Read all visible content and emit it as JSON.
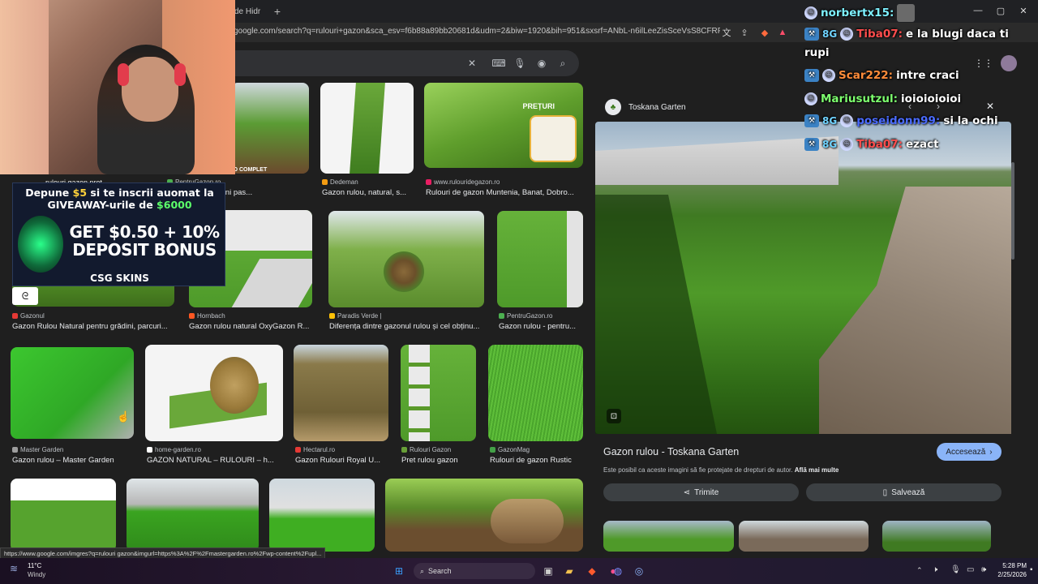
{
  "browser": {
    "tab_partial": "de Hidr",
    "url": "google.com/search?q=rulouri+gazon&sca_esv=f6b88a89bb20681d&udm=2&biw=1920&bih=951&sxsrf=ANbL-n6ilLeeZisSceVsS8CFRF9ZWOZ..."
  },
  "results": [
    {
      "source": "PentruGazon.ro",
      "caption": "...ontaj, instructiuni pas..."
    },
    {
      "source": "Dedeman",
      "caption": "Gazon rulou, natural, s..."
    },
    {
      "source": "www.rulouridegazon.ro",
      "caption": "Rulouri de gazon Muntenia, Banat, Dobro...",
      "badge": "PREȚURI"
    },
    {
      "source": "Gazonul",
      "caption": "Gazon Rulou Natural pentru grădini, parcuri..."
    },
    {
      "source": "Hornbach",
      "caption": "Gazon rulou natural OxyGazon R..."
    },
    {
      "source": "Paradis Verde |",
      "caption": "Diferența dintre gazonul rulou și cel obținu..."
    },
    {
      "source": "PentruGazon.ro",
      "caption": "Gazon rulou - pentru..."
    },
    {
      "source": "Master Garden",
      "caption": "Gazon rulou – Master Garden"
    },
    {
      "source": "home-garden.ro",
      "caption": "GAZON NATURAL – RULOURI – h..."
    },
    {
      "source": "Hectarul.ro",
      "caption": "Gazon Rulouri Royal U..."
    },
    {
      "source": "Rulouri Gazon",
      "caption": "Pret rulou gazon"
    },
    {
      "source": "GazonMag",
      "caption": "Rulouri de gazon Rustic"
    }
  ],
  "partial_first": "rulouri gazon pret",
  "partial_complet": "D COMPLET",
  "panel": {
    "site": "Toskana Garten",
    "title": "Gazon rulou - Toskana Garten",
    "visit": "Accesează",
    "notice": "Este posibil ca aceste imagini să fie protejate de drepturi de autor.",
    "notice_link": "Află mai multe",
    "share": "Trimite",
    "save": "Salvează"
  },
  "chat": [
    {
      "user": "norbertx15:",
      "user_color": "#7df0ff",
      "msg": ""
    },
    {
      "user": "Tiba07:",
      "user_color": "#ff4d4d",
      "msg": "e la blugi daca ti"
    },
    {
      "user": "",
      "user_color": "#ffffff",
      "msg": "rupi"
    },
    {
      "user": "Scar222:",
      "user_color": "#ff8c3a",
      "msg": "intre craci"
    },
    {
      "user": "Mariusutzul:",
      "user_color": "#7dff6e",
      "msg": "ioioioioioi"
    },
    {
      "user": "poseidonn99:",
      "user_color": "#4a6bff",
      "msg": "si la ochi"
    },
    {
      "user": "Tiba07:",
      "user_color": "#ff4d4d",
      "msg": "ezact"
    }
  ],
  "ad": {
    "line1a": "Depune ",
    "line1b": "$5",
    "line1c": " si te inscrii auomat la",
    "line2a": "GIVEAWAY-urile de ",
    "line2b": "$6000",
    "line3": "GET $0.50 + 10%",
    "line4": "DEPOSIT BONUS",
    "brand": "CSG SKINS"
  },
  "status_url": "https://www.google.com/imgres?q=rulouri gazon&imgurl=https%3A%2F%2Fmastergarden.ro%2Fwp-content%2Fupl...",
  "taskbar": {
    "weather_temp": "11°C",
    "weather_desc": "Windy",
    "search": "Search",
    "time": "5:28 PM",
    "date": "2/25/2026"
  },
  "colors": {
    "accent": "#8ab4f8",
    "visit_bg": "#8ab4f8",
    "panel_btn": "#3c4043"
  }
}
